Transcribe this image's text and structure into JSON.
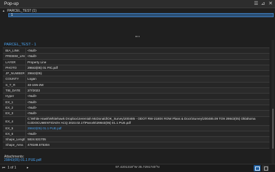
{
  "window": {
    "title": "Pop-up",
    "menu_icon": "menu-icon",
    "pin_icon": "pin-icon",
    "close_icon": "close-icon"
  },
  "tree": {
    "layer_label": "PARCEL_TEST (1)",
    "selected_feature": "1"
  },
  "panel": {
    "section_title": "PARCEL_TEST - 1",
    "attributes": [
      {
        "field": "BIA_LINK",
        "value": "<Null>"
      },
      {
        "field": "PREBIW_LINK",
        "value": "<Null>"
      },
      {
        "field": "LAYER",
        "value": "Property Line"
      },
      {
        "field": "PHOTO",
        "value": "29843(05) 01 PIC.pdf"
      },
      {
        "field": "JP_NUMBER",
        "value": "29843(05)"
      },
      {
        "field": "COUNTY",
        "value": "Logan"
      },
      {
        "field": "S_T_R",
        "value": "33-15N-2W"
      },
      {
        "field": "TIB_DATE",
        "value": "2/7/2023"
      },
      {
        "field": "Hyper",
        "value": "<Null>"
      },
      {
        "field": "EX_1",
        "value": "<Null>"
      },
      {
        "field": "EX_2",
        "value": "<Null>"
      },
      {
        "field": "EX_3",
        "value": "<Null>"
      },
      {
        "field": "EX_4",
        "value": "C:\\White Hawk\\Whitehawk Dropbox\\Jeremiah McDonald\\OK_Survey\\200485 - ODOT RW-2180X ROW Plans & Docs\\Survey\\200485.09 TO9 29843(05) Oklahoma Co\\DOCUMENTS\\ADV ACQ 2023.02.17\\Parcels\\29843(05) 01.1 PUE.pdf"
      },
      {
        "field": "EX_5",
        "value": "29843(05) 01.1 PUE.pdf"
      },
      {
        "field": "EX_6",
        "value": "<Null>"
      },
      {
        "field": "Shape_Length",
        "value": "5824.531705"
      },
      {
        "field": "Shape_Area",
        "value": "478188.575304"
      }
    ],
    "attachments_label": "Attachments:",
    "attachment_file": "29843(05) 01.1 PUE.pdf"
  },
  "statusbar": {
    "first_icon": "first-page-icon",
    "nav_label": "1 of 1",
    "next_icon": "next-page-icon",
    "coordinates": "97.4201318°W 35.7291740°N",
    "zoom_icon": "zoom-to-icon",
    "flash_icon": "flash-feature-icon"
  }
}
